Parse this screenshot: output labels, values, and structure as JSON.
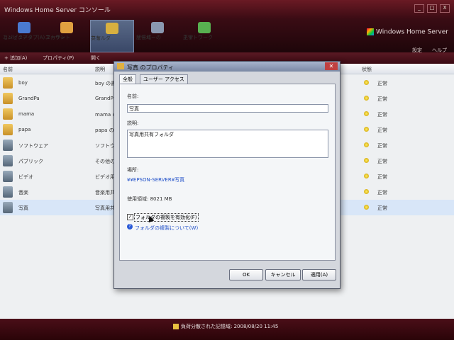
{
  "app": {
    "title": "Windows Home Server コンソール",
    "brand": "Windows Home Server",
    "header_links": [
      "設定",
      "ヘルプ"
    ],
    "window_buttons": [
      "_",
      "□",
      "X"
    ]
  },
  "nav_tabs": [
    {
      "label1": "コンピュータ",
      "label2": "とバックアップ(A)",
      "icon": "computer-icon",
      "color": "#4a7ad0"
    },
    {
      "label1": "ユーザー",
      "label2": "アカウント",
      "icon": "users-icon",
      "color": "#e0a040"
    },
    {
      "label1": "共有",
      "label2": "フォルダ",
      "icon": "shared-folder-icon",
      "color": "#d8b040"
    },
    {
      "label1": "サーバーの",
      "label2": "記憶域",
      "icon": "storage-icon",
      "color": "#8a98b0"
    },
    {
      "label1": "ネットワーク",
      "label2": "正常",
      "icon": "network-icon",
      "color": "#58b050"
    }
  ],
  "commands": [
    "+ 追加(A)",
    "プロパティ(P)",
    "開く"
  ],
  "columns": {
    "name": "名前",
    "description": "説明",
    "status": "状態"
  },
  "rows": [
    {
      "name": "boy",
      "desc": "boy の書...",
      "status": "正常"
    },
    {
      "name": "GrandPa",
      "desc": "GrandPa...",
      "status": "正常"
    },
    {
      "name": "mama",
      "desc": "mama の書",
      "status": "正常"
    },
    {
      "name": "papa",
      "desc": "papa の書",
      "status": "正常"
    },
    {
      "name": "ソフトウェア",
      "desc": "ソフトウェア",
      "status": "正常"
    },
    {
      "name": "パブリック",
      "desc": "その他の...",
      "status": "正常"
    },
    {
      "name": "ビデオ",
      "desc": "ビデオ用共",
      "status": "正常"
    },
    {
      "name": "音楽",
      "desc": "音楽用共",
      "status": "正常"
    },
    {
      "name": "写真",
      "desc": "写真用共",
      "status": "正常"
    }
  ],
  "dialog": {
    "title": "写真 のプロパティ",
    "tabs": [
      "全般",
      "ユーザー アクセス"
    ],
    "name_label": "名前:",
    "name_value": "写真",
    "desc_label": "説明:",
    "desc_value": "写真用共有フォルダ",
    "location_label": "場所:",
    "location_value": "¥¥EPSON-SERVER¥写真",
    "used_label": "使用領域: 8021 MB",
    "dup_checkbox": "フォルダの複製を有効化(F)",
    "dup_checked": true,
    "help_link": "フォルダの複製について(W)",
    "buttons": {
      "ok": "OK",
      "cancel": "キャンセル",
      "apply": "適用(A)"
    }
  },
  "status_bar": "負荷分散された記憶域: 2008/08/20 11:45"
}
